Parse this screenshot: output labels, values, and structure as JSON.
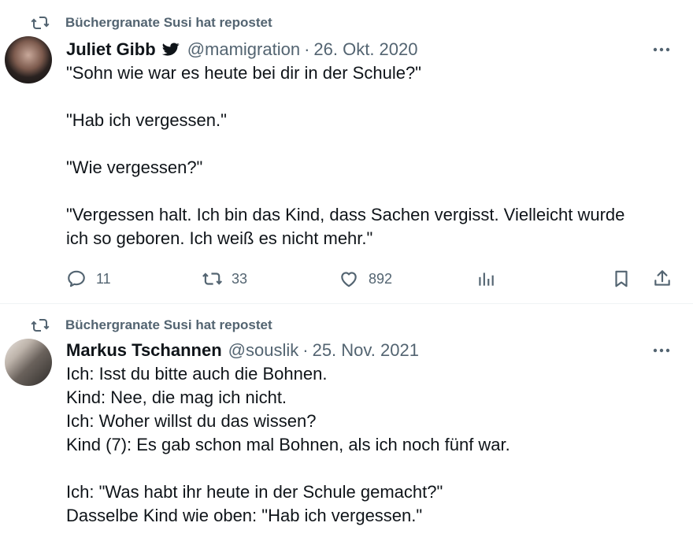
{
  "tweets": [
    {
      "repost_text": "Büchergranate Susi hat repostet",
      "author_name": "Juliet Gibb",
      "handle": "@mamigration",
      "separator": "·",
      "date": "26. Okt. 2020",
      "lines": [
        "\"Sohn wie war es heute bei dir in der Schule?\"",
        "",
        "\"Hab ich vergessen.\"",
        "",
        "\"Wie vergessen?\"",
        "",
        "\"Vergessen halt. Ich bin das Kind, dass Sachen vergisst. Vielleicht wurde",
        "ich so geboren. Ich weiß es nicht mehr.\""
      ],
      "replies": "11",
      "reposts": "33",
      "likes": "892"
    },
    {
      "repost_text": "Büchergranate Susi hat repostet",
      "author_name": "Markus Tschannen",
      "handle": "@souslik",
      "separator": "·",
      "date": "25. Nov. 2021",
      "lines": [
        "Ich: Isst du bitte auch die Bohnen.",
        "Kind: Nee, die mag ich nicht.",
        "Ich: Woher willst du das wissen?",
        "Kind (7): Es gab schon mal Bohnen, als ich noch fünf war.",
        "",
        "Ich: \"Was habt ihr heute in der Schule gemacht?\"",
        "Dasselbe Kind wie oben: \"Hab ich vergessen.\""
      ]
    }
  ],
  "colors": {
    "text": "#0f1419",
    "secondary": "#536471",
    "divider": "#eff3f4",
    "verified": "#0f1419"
  },
  "icons": [
    "repost-icon",
    "verified-icon",
    "more-icon",
    "reply-icon",
    "like-icon",
    "views-icon",
    "bookmark-icon",
    "share-icon"
  ]
}
